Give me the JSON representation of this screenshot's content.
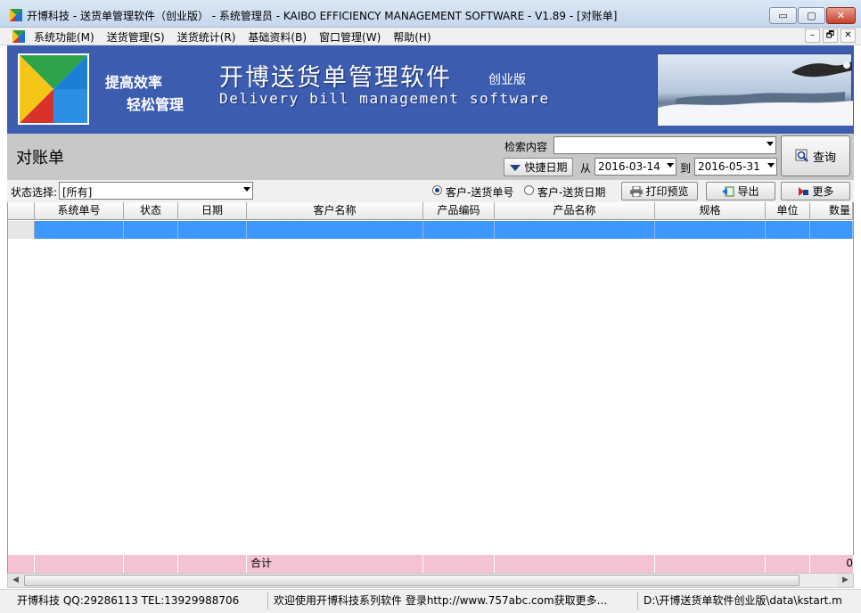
{
  "window": {
    "title": "开博科技 - 送货单管理软件（创业版） - 系统管理员 - KAIBO EFFICIENCY MANAGEMENT SOFTWARE - V1.89 - [对账单]",
    "min_label": "▭",
    "max_label": "▢",
    "close_label": "✕"
  },
  "menu": {
    "items": [
      {
        "label": "系统功能(M)"
      },
      {
        "label": "送货管理(S)"
      },
      {
        "label": "送货统计(R)"
      },
      {
        "label": "基础资料(B)"
      },
      {
        "label": "窗口管理(W)"
      },
      {
        "label": "帮助(H)"
      }
    ],
    "mdi_min": "–",
    "mdi_restore": "🗗",
    "mdi_close": "✕"
  },
  "banner": {
    "slogan1": "提高效率",
    "slogan2": "轻松管理",
    "title": "开博送货单管理软件",
    "edition": "创业版",
    "subtitle": "Delivery bill management software"
  },
  "header": {
    "page_title": "对账单",
    "search_label": "检索内容",
    "search_value": "",
    "quick_date_label": "快捷日期",
    "from_label": "从",
    "from_date": "2016-03-14",
    "to_label": "到",
    "to_date": "2016-05-31",
    "query_label": "查询"
  },
  "filter": {
    "status_label": "状态选择:",
    "status_value": "[所有]",
    "radio1": "客户-送货单号",
    "radio2": "客户-送货日期",
    "print_label": "打印预览",
    "export_label": "导出",
    "more_label": "更多"
  },
  "grid": {
    "columns": [
      "系统单号",
      "状态",
      "日期",
      "客户名称",
      "产品编码",
      "产品名称",
      "规格",
      "单位",
      "数量"
    ],
    "sum_label": "合计",
    "sum_tail": "0"
  },
  "status_bar": {
    "company": "开博科技 QQ:29286113 TEL:13929988706",
    "welcome": "欢迎使用开博科技系列软件  登录http://www.757abc.com获取更多...",
    "path": "D:\\开博送货单软件创业版\\data\\kstart.m"
  },
  "colors": {
    "banner_blue": "#3c5cb0",
    "selected_row": "#3c97ff",
    "sum_row_pink": "#f4c2d4"
  }
}
